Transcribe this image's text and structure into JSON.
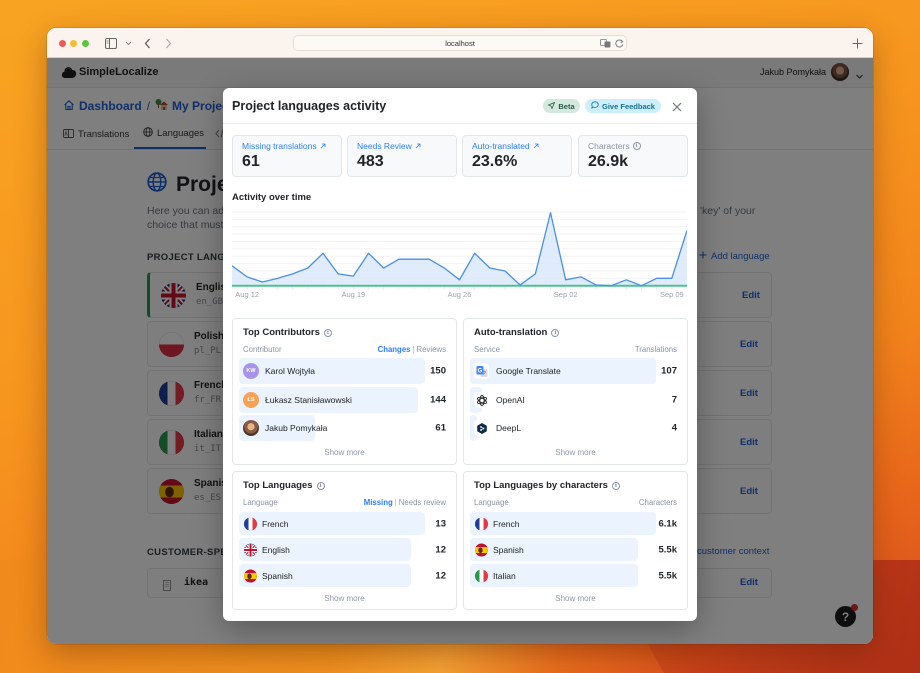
{
  "browser": {
    "url": "localhost"
  },
  "app": {
    "brand": "SimpleLocalize",
    "user_name": "Jakub Pomykała",
    "breadcrumb": {
      "dashboard": "Dashboard",
      "separator": "/",
      "project": "My Project",
      "project_icon": "house-with-garden"
    },
    "tabs": [
      {
        "label": "Translations",
        "icon": "translations-icon"
      },
      {
        "label": "Languages",
        "icon": "globe-icon",
        "active": true
      },
      {
        "label": "",
        "icon": "code-icon"
      }
    ],
    "page_title": "Project languages",
    "description": {
      "line1_left": "Here you can add",
      "line1_right": "'key' of your",
      "line2_left": "choice that must"
    },
    "languages_section": {
      "title": "PROJECT LANGUAGES",
      "add_label": "Add language"
    },
    "languages": [
      {
        "name": "English",
        "code": "en_GB",
        "flag": "gb",
        "active": true
      },
      {
        "name": "Polish",
        "code": "pl_PL",
        "flag": "pl"
      },
      {
        "name": "French",
        "code": "fr_FR",
        "flag": "fr"
      },
      {
        "name": "Italian",
        "code": "it_IT",
        "flag": "it"
      },
      {
        "name": "Spanish",
        "code": "es_ES",
        "flag": "es"
      }
    ],
    "edit_label": "Edit",
    "customer_section": {
      "title": "CUSTOMER-SPECIFIC",
      "add_label": "customer context"
    },
    "customers": [
      {
        "name": "ikea"
      }
    ],
    "help_label": "?"
  },
  "modal": {
    "title": "Project languages activity",
    "beta_label": "Beta",
    "feedback_label": "Give Feedback",
    "stats": [
      {
        "label": "Missing translations",
        "value": "61"
      },
      {
        "label": "Needs Review",
        "value": "483"
      },
      {
        "label": "Auto-translated",
        "value": "23.6%"
      },
      {
        "label": "Characters",
        "value": "26.9k"
      }
    ],
    "activity_title": "Activity over time",
    "contributors": {
      "title": "Top Contributors",
      "col_left": "Contributor",
      "col_right_active": "Changes",
      "col_right_separator": "|",
      "col_right_inactive": "Reviews",
      "rows": [
        {
          "name": "Karol Wojtyła",
          "initials": "KW",
          "value": 150,
          "avatar_color": "#a893ec"
        },
        {
          "name": "Łukasz Stanisławowski",
          "initials": "ŁS",
          "value": 144,
          "avatar_color": "#f8a153"
        },
        {
          "name": "Jakub Pomykała",
          "initials": "",
          "value": 61,
          "avatar": "photo"
        }
      ],
      "show_more": "Show more"
    },
    "auto_translation": {
      "title": "Auto-translation",
      "col_left": "Service",
      "col_right": "Translations",
      "rows": [
        {
          "name": "Google Translate",
          "icon": "google-translate",
          "value": 107
        },
        {
          "name": "OpenAI",
          "icon": "openai",
          "value": 7
        },
        {
          "name": "DeepL",
          "icon": "deepl",
          "value": 4
        }
      ],
      "show_more": "Show more"
    },
    "top_languages": {
      "title": "Top Languages",
      "col_left": "Language",
      "col_right_active": "Missing",
      "col_right_separator": "|",
      "col_right_inactive": "Needs review",
      "rows": [
        {
          "name": "French",
          "flag": "fr",
          "value": 13
        },
        {
          "name": "English",
          "flag": "gb",
          "value": 12
        },
        {
          "name": "Spanish",
          "flag": "es",
          "value": 12
        }
      ],
      "show_more": "Show more"
    },
    "top_languages_chars": {
      "title": "Top Languages by characters",
      "col_left": "Language",
      "col_right": "Characters",
      "rows": [
        {
          "name": "French",
          "flag": "fr",
          "value": 6100,
          "display": "6.1k"
        },
        {
          "name": "Spanish",
          "flag": "es",
          "value": 5500,
          "display": "5.5k"
        },
        {
          "name": "Italian",
          "flag": "it",
          "value": 5500,
          "display": "5.5k"
        }
      ],
      "show_more": "Show more"
    }
  },
  "colors": {
    "accent": "#2d7ff9",
    "link": "#1f5fd6",
    "bar_fill": "#eaf3fe",
    "active_language": "#1e9e4a",
    "chart_line": "#4a8fe6",
    "chart_area": "#dbe9fb",
    "chart_baseline": "#4cc38a",
    "beta_bg": "#d3e9df",
    "feedback_bg": "#cdeffb"
  },
  "chart_data": {
    "type": "area",
    "title": "Activity over time",
    "xlabel": "",
    "ylabel": "",
    "x": [
      "Aug 11",
      "Aug 12",
      "Aug 13",
      "Aug 14",
      "Aug 15",
      "Aug 16",
      "Aug 17",
      "Aug 18",
      "Aug 19",
      "Aug 20",
      "Aug 21",
      "Aug 22",
      "Aug 23",
      "Aug 24",
      "Aug 25",
      "Aug 26",
      "Aug 27",
      "Aug 28",
      "Aug 29",
      "Aug 30",
      "Aug 31",
      "Sep 01",
      "Sep 02",
      "Sep 03",
      "Sep 04",
      "Sep 05",
      "Sep 06",
      "Sep 07",
      "Sep 08",
      "Sep 09",
      "Sep 10"
    ],
    "x_tick_labels": [
      "Aug 12",
      "Aug 19",
      "Aug 26",
      "Sep 02",
      "Sep 09"
    ],
    "x_tick_indices": [
      1,
      8,
      15,
      22,
      29
    ],
    "series": [
      {
        "name": "activity",
        "color": "#4a8fe6",
        "values": [
          2.7,
          1.2,
          0.5,
          1.0,
          1.6,
          2.4,
          4.4,
          1.6,
          1.3,
          4.4,
          2.4,
          3.6,
          3.6,
          3.6,
          2.4,
          0.8,
          4.4,
          2.4,
          2.0,
          0.1,
          1.6,
          9.9,
          0.8,
          1.2,
          0.1,
          0.0,
          0.8,
          0.0,
          1.0,
          1.0,
          7.5
        ]
      },
      {
        "name": "baseline",
        "color": "#4cc38a",
        "values": [
          0,
          0,
          0,
          0,
          0,
          0,
          0,
          0,
          0,
          0,
          0,
          0,
          0,
          0,
          0,
          0,
          0,
          0,
          0,
          0,
          0,
          0,
          0,
          0,
          0,
          0,
          0,
          0,
          0,
          0,
          0
        ]
      }
    ],
    "ylim": [
      0,
      10
    ],
    "y_gridlines": 10,
    "y_axis_labels_visible": false,
    "grid": true,
    "legend": "none"
  }
}
